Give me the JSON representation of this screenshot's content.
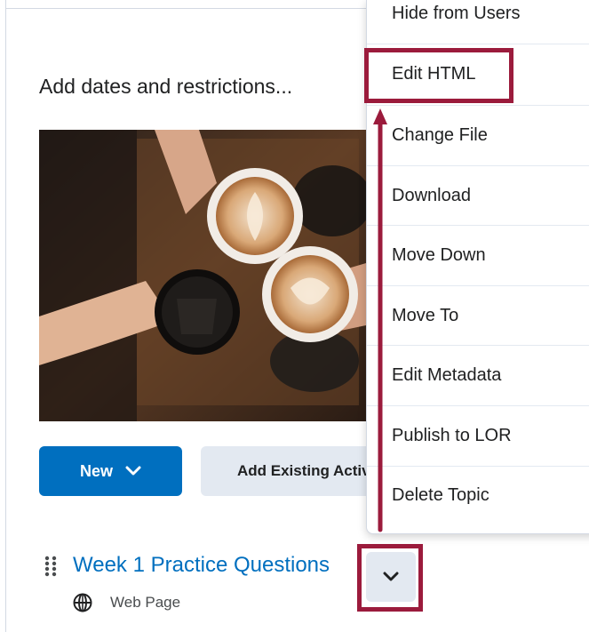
{
  "heading": "Add dates and restrictions...",
  "buttons": {
    "new_label": "New",
    "add_existing_label": "Add Existing Activities"
  },
  "topic": {
    "title": "Week 1 Practice Questions",
    "type_label": "Web Page"
  },
  "menu": {
    "items": [
      {
        "label": "Hide from Users"
      },
      {
        "label": "Edit HTML"
      },
      {
        "label": "Change File"
      },
      {
        "label": "Download"
      },
      {
        "label": "Move Down"
      },
      {
        "label": "Move To"
      },
      {
        "label": "Edit Metadata"
      },
      {
        "label": "Publish to LOR"
      },
      {
        "label": "Delete Topic"
      }
    ]
  },
  "colors": {
    "primary": "#006fbf",
    "highlight": "#9b1b3c",
    "secondary_button_bg": "#e3e9f1"
  },
  "icons": {
    "new_button": "chevron-down-icon",
    "drag": "drag-handle-icon",
    "topic_type": "globe-icon",
    "options": "chevron-down-icon"
  }
}
